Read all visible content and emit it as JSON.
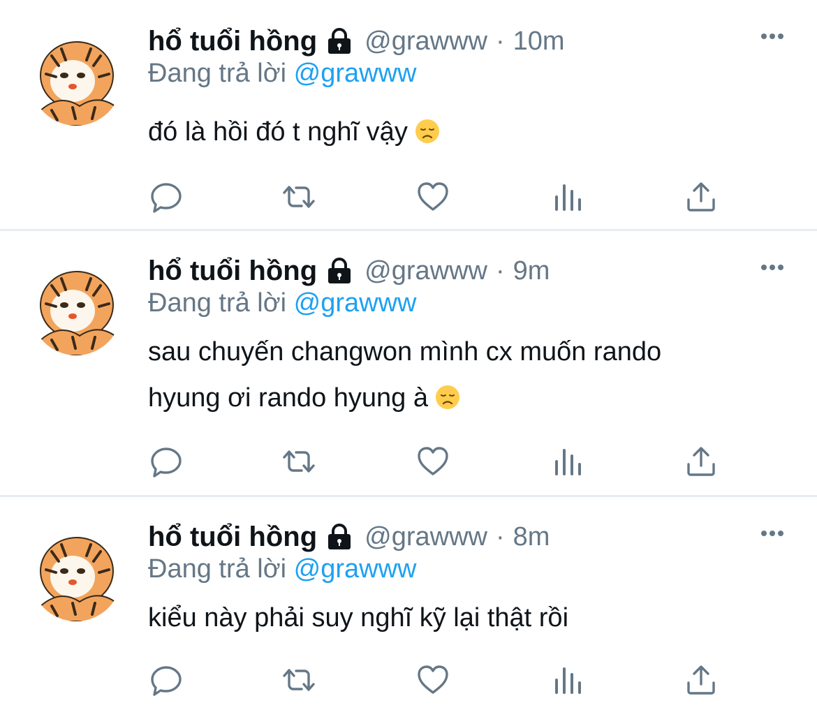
{
  "tweets": [
    {
      "name": "hổ tuổi hồng",
      "handle": "@grawww",
      "separator": "·",
      "time": "10m",
      "reply_prefix": "Đang trả lời",
      "reply_to": "@grawww",
      "lines": [
        "đó là hồi đó t nghĩ vậy"
      ],
      "emoji": "disappointed-face"
    },
    {
      "name": "hổ tuổi hồng",
      "handle": "@grawww",
      "separator": "·",
      "time": "9m",
      "reply_prefix": "Đang trả lời",
      "reply_to": "@grawww",
      "lines": [
        "sau chuyến changwon mình cx muốn rando",
        "hyung ơi rando hyung à"
      ],
      "emoji": "disappointed-face"
    },
    {
      "name": "hổ tuổi hồng",
      "handle": "@grawww",
      "separator": "·",
      "time": "8m",
      "reply_prefix": "Đang trả lời",
      "reply_to": "@grawww",
      "lines": [
        "kiểu này phải suy nghĩ kỹ lại thật rồi"
      ],
      "emoji": ""
    }
  ],
  "icons": {
    "lock": "lock-icon",
    "more": "more-icon",
    "reply": "reply-icon",
    "retweet": "retweet-icon",
    "like": "like-icon",
    "analytics": "analytics-icon",
    "share": "share-icon"
  },
  "colors": {
    "text": "#0f1419",
    "secondary": "#657786",
    "mention": "#1da1f2",
    "divider": "#e6ecf0"
  }
}
